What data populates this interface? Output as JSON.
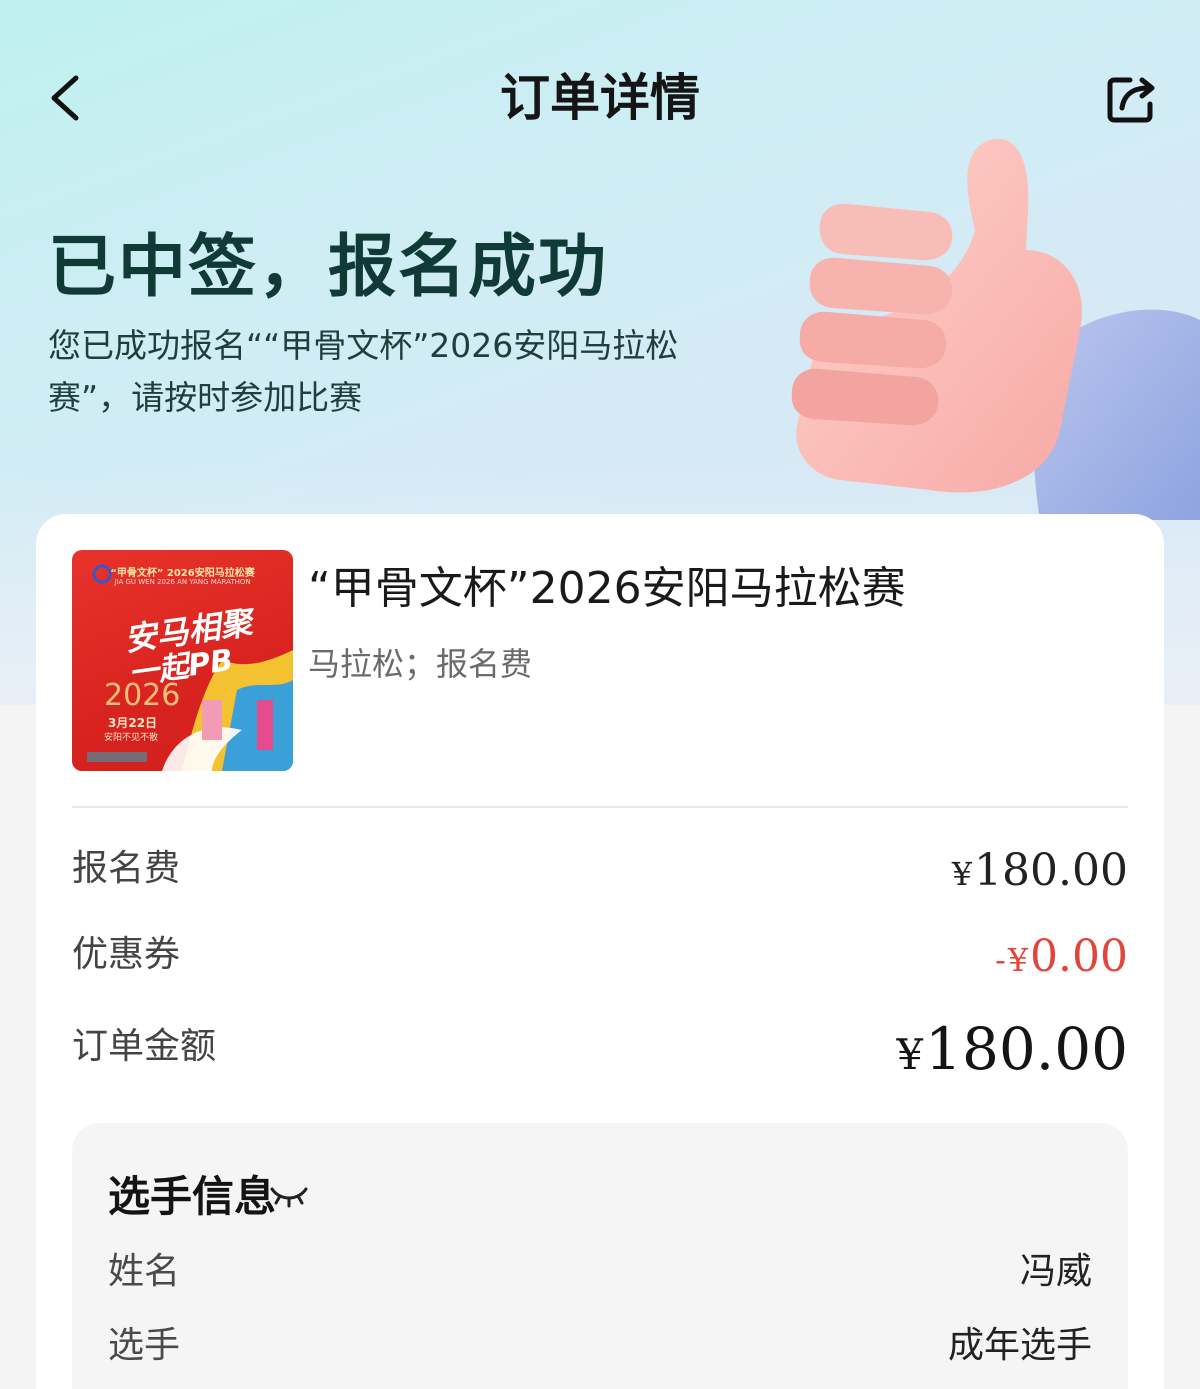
{
  "header": {
    "title": "订单详情",
    "back_icon": "chevron-left-icon",
    "share_icon": "share-icon"
  },
  "hero": {
    "title": "已中签，报名成功",
    "description": "您已成功报名““甲骨文杯”2026安阳马拉松赛”，请按时参加比赛",
    "illustration": "thumbs-up-illustration"
  },
  "event": {
    "title": "“甲骨文杯”2026安阳马拉松赛",
    "meta": "马拉松；报名费",
    "poster": {
      "top_text": "“甲骨文杯” 2026安阳马拉松赛",
      "sub_text": "JIA GU WEN 2026 AN YANG MARATHON",
      "slogan_line1": "安马相聚",
      "slogan_line2": "一起PB",
      "year": "2026",
      "date": "3月22日",
      "tagline": "安阳不见不散"
    }
  },
  "fees": {
    "registration": {
      "label": "报名费",
      "currency": "¥",
      "amount": "180.00"
    },
    "coupon": {
      "label": "优惠券",
      "prefix": "-",
      "currency": "¥",
      "amount": "0.00"
    },
    "total": {
      "label": "订单金额",
      "currency": "¥",
      "amount": "180.00"
    }
  },
  "participant": {
    "title": "选手信息",
    "visibility_icon": "eye-closed-icon",
    "fields": [
      {
        "label": "姓名",
        "value": "冯威"
      },
      {
        "label": "选手",
        "value": "成年选手"
      }
    ]
  },
  "colors": {
    "accent_dark_teal": "#0f3a35",
    "discount_red": "#e0463c",
    "poster_red": "#d8231f"
  }
}
